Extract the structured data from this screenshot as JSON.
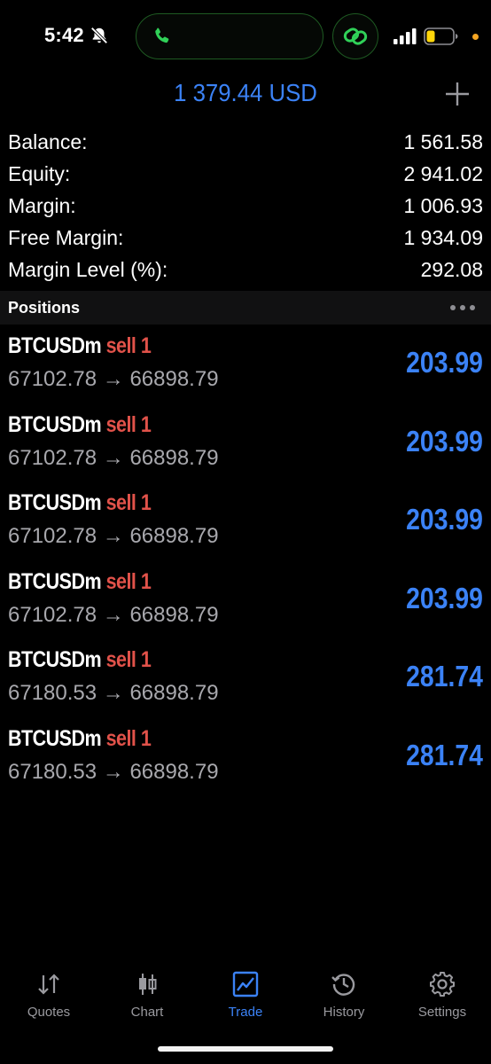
{
  "status_bar": {
    "time": "5:42",
    "accent_green": "#30d158",
    "battery_color": "#ffd60a",
    "privacy_dot_color": "#f5a623"
  },
  "header": {
    "title": "1 379.44 USD",
    "add_icon": "plus-icon",
    "accent": "#3b82f6"
  },
  "summary": [
    {
      "label": "Balance:",
      "value": "1 561.58"
    },
    {
      "label": "Equity:",
      "value": "2 941.02"
    },
    {
      "label": "Margin:",
      "value": "1 006.93"
    },
    {
      "label": "Free Margin:",
      "value": "1 934.09"
    },
    {
      "label": "Margin Level (%):",
      "value": "292.08"
    }
  ],
  "positions": {
    "title": "Positions",
    "items": [
      {
        "symbol": "BTCUSDm",
        "side": "sell 1",
        "prices": "67102.78 → 66898.79",
        "profit": "203.99"
      },
      {
        "symbol": "BTCUSDm",
        "side": "sell 1",
        "prices": "67102.78 → 66898.79",
        "profit": "203.99"
      },
      {
        "symbol": "BTCUSDm",
        "side": "sell 1",
        "prices": "67102.78 → 66898.79",
        "profit": "203.99"
      },
      {
        "symbol": "BTCUSDm",
        "side": "sell 1",
        "prices": "67102.78 → 66898.79",
        "profit": "203.99"
      },
      {
        "symbol": "BTCUSDm",
        "side": "sell 1",
        "prices": "67180.53 → 66898.79",
        "profit": "281.74"
      },
      {
        "symbol": "BTCUSDm",
        "side": "sell 1",
        "prices": "67180.53 → 66898.79",
        "profit": "281.74"
      }
    ]
  },
  "tabs": [
    {
      "label": "Quotes",
      "icon": "quotes-arrows-icon"
    },
    {
      "label": "Chart",
      "icon": "candlestick-icon"
    },
    {
      "label": "Trade",
      "icon": "trade-chart-icon",
      "active": true
    },
    {
      "label": "History",
      "icon": "history-clock-icon"
    },
    {
      "label": "Settings",
      "icon": "gear-icon"
    }
  ]
}
